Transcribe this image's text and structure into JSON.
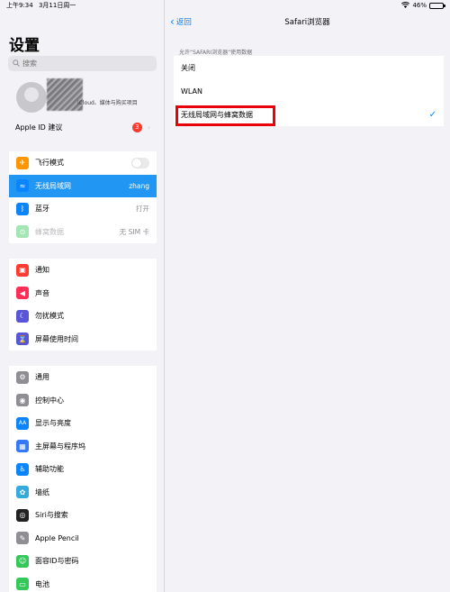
{
  "statusbar": {
    "time": "上午9:34",
    "date": "3月11日周一",
    "wifi_icon": "wifi-icon",
    "battery_percent": "46%",
    "battery_level": 0.46
  },
  "sidebar": {
    "title": "设置",
    "search_placeholder": "搜索",
    "profile": {
      "subtitle": "iCloud、媒体与购买项目",
      "apple_id_suggestions": "Apple ID 建议",
      "badge": "3"
    },
    "group1": [
      {
        "label": "飞行模式",
        "icon": "airplane-icon",
        "color": "#ff9500",
        "glyph": "✈",
        "toggle": true
      },
      {
        "label": "无线局域网",
        "icon": "wifi-icon",
        "color": "#0a84ff",
        "glyph": "≈",
        "value": "zhang",
        "selected": true
      },
      {
        "label": "蓝牙",
        "icon": "bluetooth-icon",
        "color": "#0a84ff",
        "glyph": "ᛒ",
        "value": "打开"
      },
      {
        "label": "蜂窝数据",
        "icon": "cellular-icon",
        "color": "#34c759",
        "glyph": "⊙",
        "value": "无 SIM 卡",
        "disabled": true
      }
    ],
    "group2": [
      {
        "label": "通知",
        "icon": "notification-icon",
        "color": "#ff3b30",
        "glyph": "▣"
      },
      {
        "label": "声音",
        "icon": "sound-icon",
        "color": "#ff2d55",
        "glyph": "◀"
      },
      {
        "label": "勿扰模式",
        "icon": "moon-icon",
        "color": "#5856d6",
        "glyph": "☾"
      },
      {
        "label": "屏幕使用时间",
        "icon": "hourglass-icon",
        "color": "#5856d6",
        "glyph": "⌛"
      }
    ],
    "group3": [
      {
        "label": "通用",
        "icon": "gear-icon",
        "color": "#8e8e93",
        "glyph": "⚙"
      },
      {
        "label": "控制中心",
        "icon": "control-center-icon",
        "color": "#8e8e93",
        "glyph": "◉"
      },
      {
        "label": "显示与亮度",
        "icon": "display-icon",
        "color": "#0a84ff",
        "glyph": "AA"
      },
      {
        "label": "主屏幕与程序坞",
        "icon": "home-screen-icon",
        "color": "#3478f6",
        "glyph": "▦"
      },
      {
        "label": "辅助功能",
        "icon": "accessibility-icon",
        "color": "#0a84ff",
        "glyph": "♿"
      },
      {
        "label": "墙纸",
        "icon": "wallpaper-icon",
        "color": "#35aadc",
        "glyph": "✿"
      },
      {
        "label": "Siri与搜索",
        "icon": "siri-icon",
        "color": "#222222",
        "glyph": "◎"
      },
      {
        "label": "Apple Pencil",
        "icon": "pencil-icon",
        "color": "#8e8e93",
        "glyph": "✎"
      },
      {
        "label": "面容ID与密码",
        "icon": "face-id-icon",
        "color": "#34c759",
        "glyph": "☺"
      },
      {
        "label": "电池",
        "icon": "battery-icon",
        "color": "#34c759",
        "glyph": "▭"
      }
    ]
  },
  "detail": {
    "back_label": "返回",
    "title": "Safari浏览器",
    "section_header": "允许“SAFARI浏览器”使用数据",
    "options": [
      {
        "label": "关闭",
        "checked": false
      },
      {
        "label": "WLAN",
        "checked": false
      },
      {
        "label": "无线局域网与蜂窝数据",
        "checked": true
      }
    ],
    "check_glyph": "✓"
  }
}
